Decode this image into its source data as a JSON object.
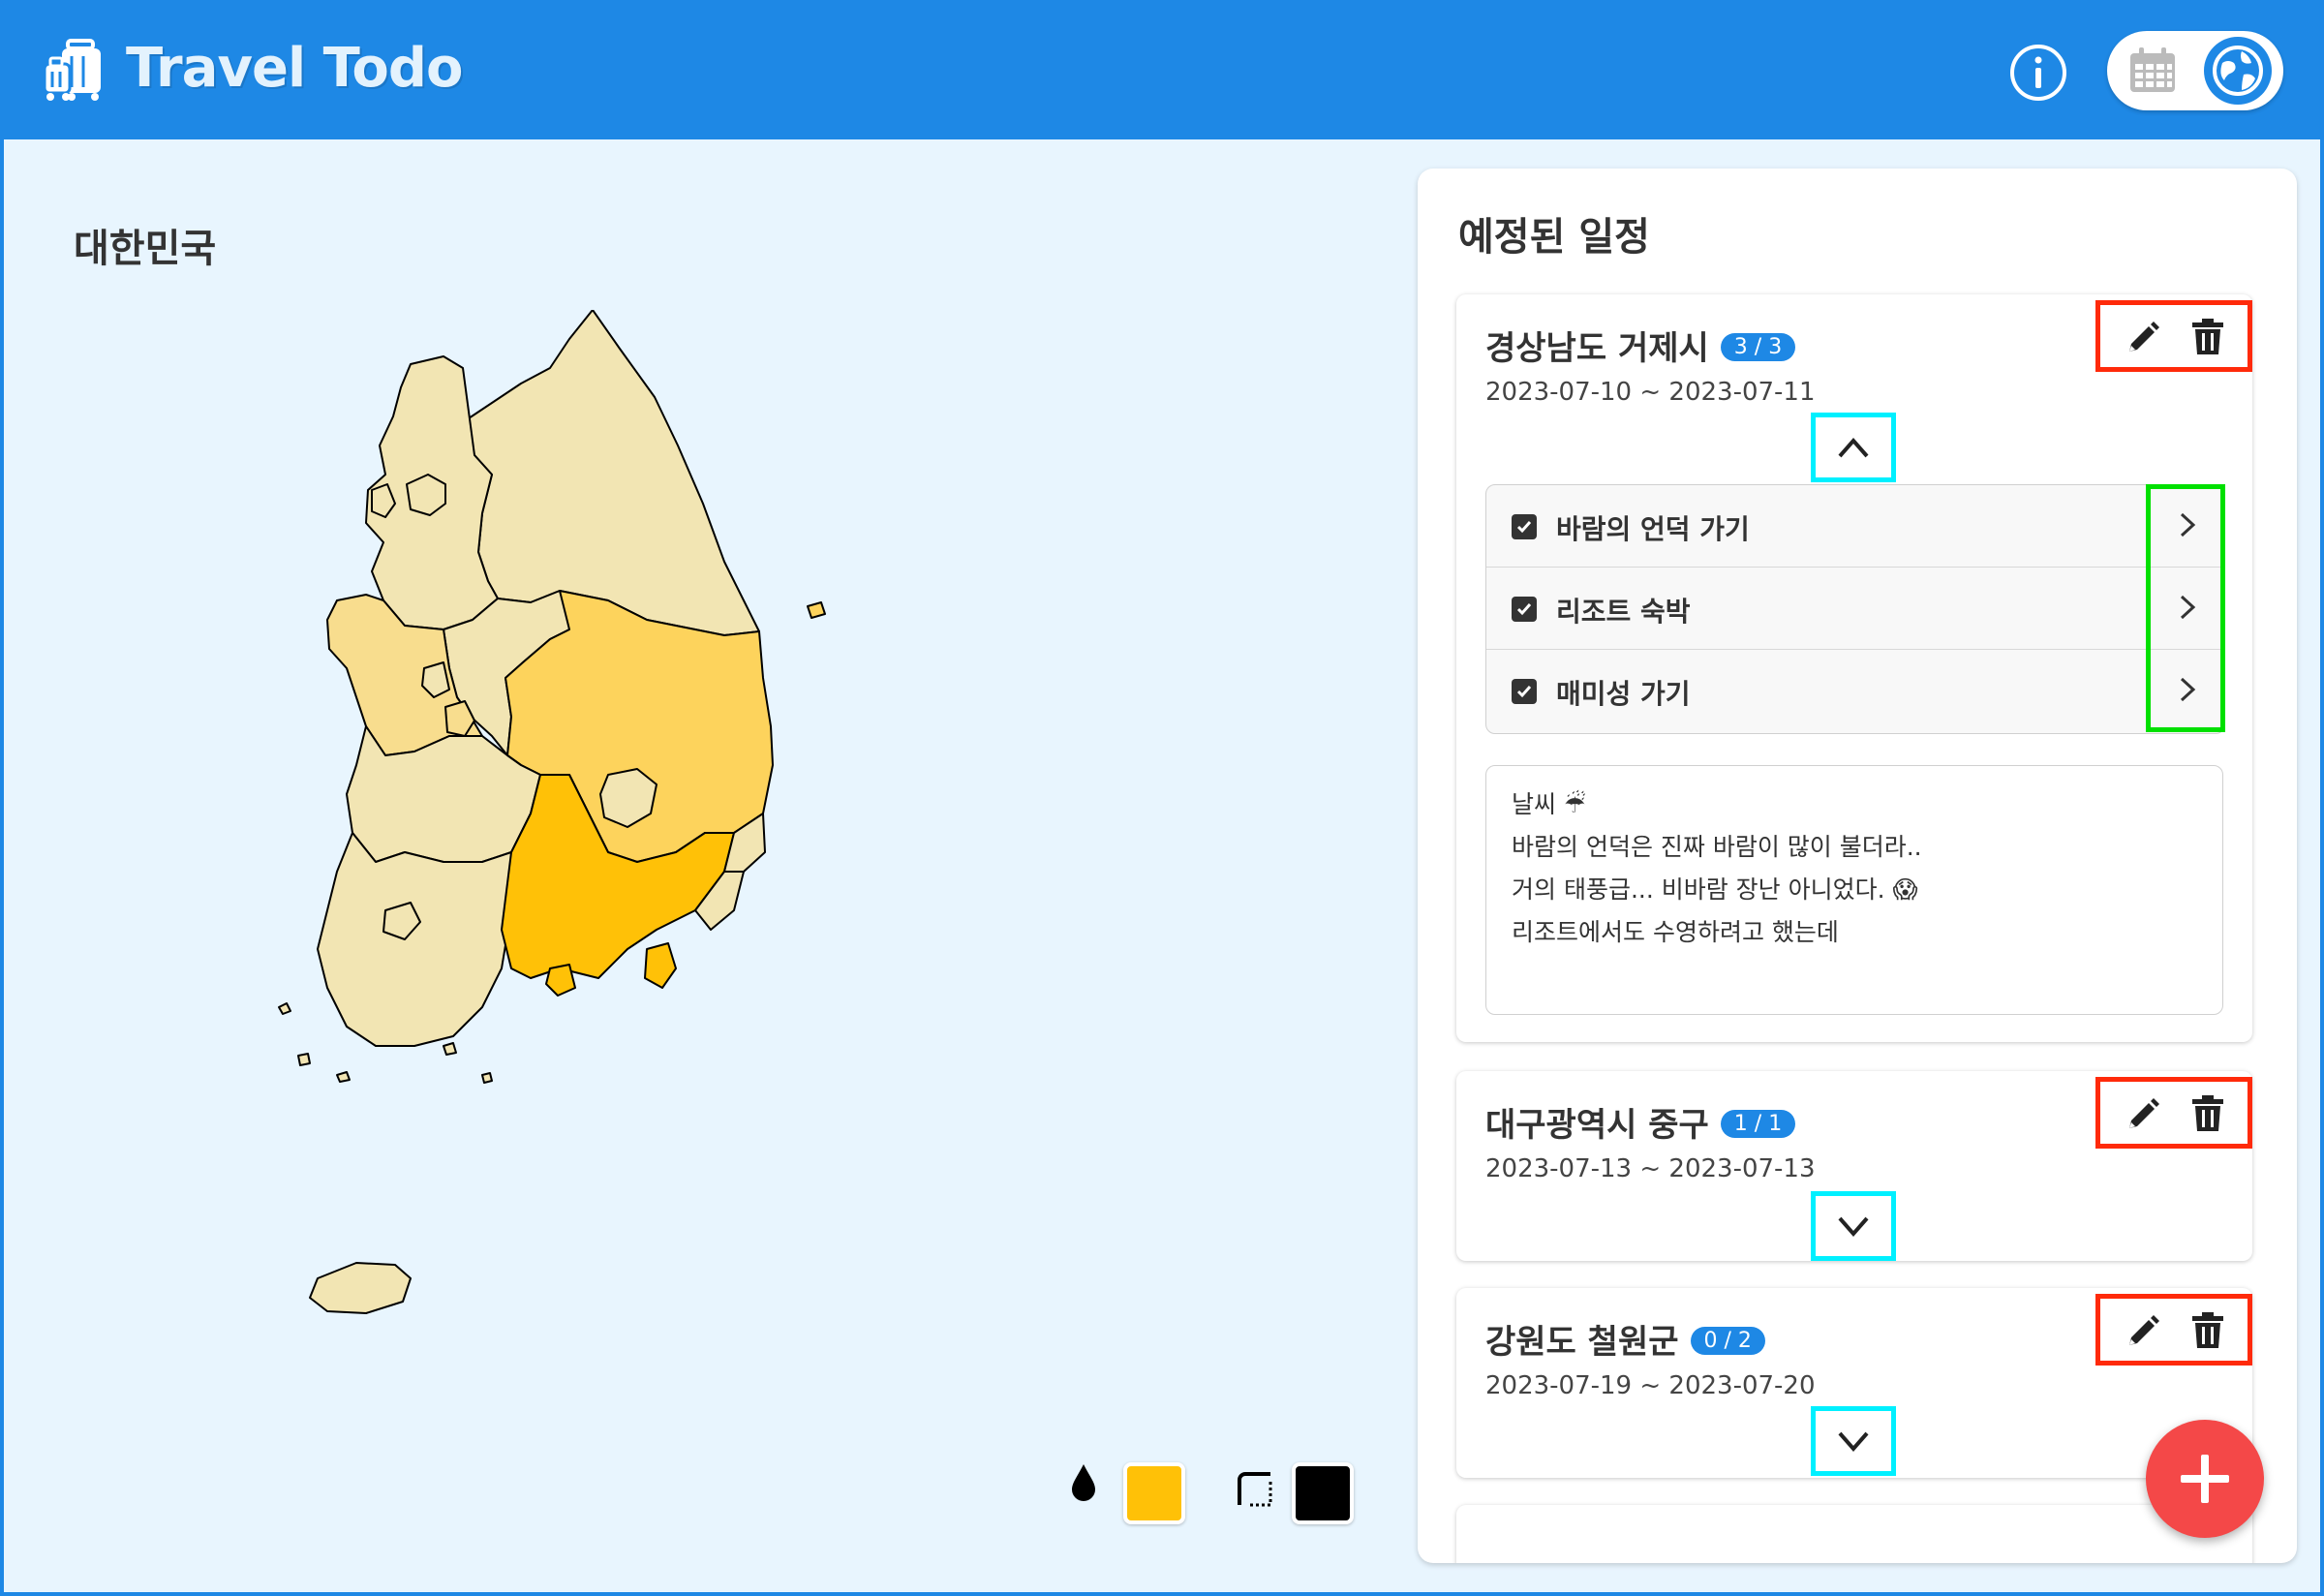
{
  "header": {
    "app_title": "Travel Todo",
    "info_icon": "info-circle-icon",
    "view_toggle": {
      "options": [
        "calendar-icon",
        "globe-map-icon"
      ],
      "active": "globe-map-icon"
    }
  },
  "map": {
    "title": "대한민국",
    "highlight_colors": {
      "highest": "#ffc107",
      "high": "#fdd35c",
      "medium": "#f8dd8e",
      "low": "#f2e5b3"
    },
    "legend": {
      "fill_icon": "drop-icon",
      "fill_color": "#ffc107",
      "border_icon": "border-style-icon",
      "border_color": "#000000"
    }
  },
  "schedule": {
    "title": "예정된 일정",
    "cards": [
      {
        "location": "경상남도 거제시",
        "badge": "3 / 3",
        "dates": "2023-07-10 ~ 2023-07-11",
        "expanded": true,
        "todos": [
          {
            "label": "바람의 언덕 가기",
            "checked": true
          },
          {
            "label": "리조트 숙박",
            "checked": true
          },
          {
            "label": "매미성 가기",
            "checked": true
          }
        ],
        "memo": [
          "날씨 ☔",
          "",
          "바람의 언덕은 진짜 바람이 많이 불더라..",
          "거의 태풍급... 비바람 장난 아니었다. 😱",
          "",
          "리조트에서도 수영하려고 했는데"
        ]
      },
      {
        "location": "대구광역시 중구",
        "badge": "1 / 1",
        "dates": "2023-07-13 ~ 2023-07-13",
        "expanded": false
      },
      {
        "location": "강원도 철원군",
        "badge": "0 / 2",
        "dates": "2023-07-19 ~ 2023-07-20",
        "expanded": false
      }
    ]
  },
  "fab": {
    "icon": "plus-icon"
  }
}
